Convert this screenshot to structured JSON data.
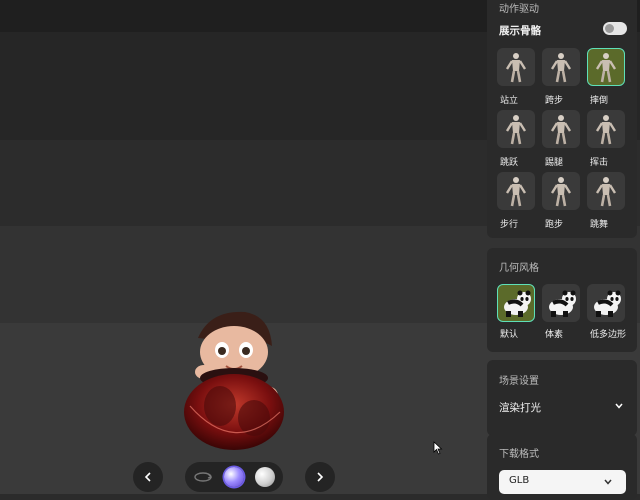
{
  "panel": {
    "motion": {
      "title": "动作驱动",
      "skeleton_label": "展示骨骼",
      "items": [
        {
          "label": "站立",
          "selected": false
        },
        {
          "label": "跨步",
          "selected": false
        },
        {
          "label": "摔倒",
          "selected": true
        },
        {
          "label": "跳跃",
          "selected": false
        },
        {
          "label": "踢腿",
          "selected": false
        },
        {
          "label": "挥击",
          "selected": false
        },
        {
          "label": "步行",
          "selected": false
        },
        {
          "label": "跑步",
          "selected": false
        },
        {
          "label": "跳舞",
          "selected": false
        }
      ]
    },
    "geometry": {
      "title": "几何风格",
      "items": [
        {
          "label": "默认",
          "selected": true
        },
        {
          "label": "体素",
          "selected": false
        },
        {
          "label": "低多边形",
          "selected": false
        }
      ]
    },
    "scene": {
      "title": "场景设置",
      "dropdown_label": "渲染打光"
    },
    "download": {
      "title": "下载格式",
      "selected_format": "GLB"
    }
  },
  "colors": {
    "accent": "#5ee0b8",
    "selected_tile": "#5b6a2a"
  }
}
